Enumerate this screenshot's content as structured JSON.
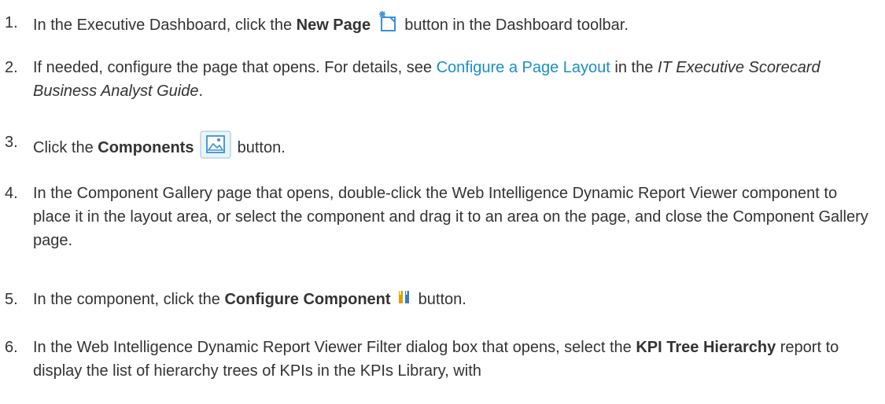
{
  "steps": [
    {
      "num": "1.",
      "pre": "In the Executive Dashboard, click the ",
      "bold": "New Page",
      "post": " button in the Dashboard toolbar.",
      "icon": "new-page-icon"
    },
    {
      "num": "2.",
      "pre": "If needed, configure the page that opens. For details, see ",
      "link": "Configure a Page Layout",
      "mid": " in the ",
      "italic": "IT Executive Scorecard Business Analyst Guide",
      "post": "."
    },
    {
      "num": "3.",
      "pre": "Click the ",
      "bold": "Components",
      "post": " button.",
      "icon": "components-icon"
    },
    {
      "num": "4.",
      "text": "In the Component Gallery page that opens, double-click the Web Intelligence Dynamic Report Viewer component to place it in the layout area, or select the component and drag it to an area on the page, and close the Component Gallery page."
    },
    {
      "num": "5.",
      "pre": "In the component, click the ",
      "bold": "Configure Component",
      "post": " button.",
      "icon": "configure-component-icon"
    },
    {
      "num": "6.",
      "pre": "In the Web Intelligence Dynamic Report Viewer Filter dialog box that opens, select the ",
      "bold": "KPI Tree Hierarchy",
      "post": " report to display the list of hierarchy trees of KPIs in the KPIs Library, with"
    }
  ],
  "colors": {
    "text": "#333333",
    "link": "#1a8fc9"
  }
}
